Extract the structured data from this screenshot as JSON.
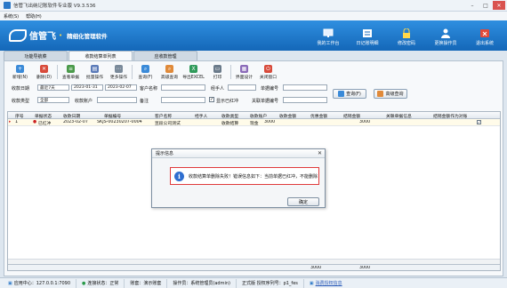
{
  "window": {
    "title": "信管飞出纳记账软件专业版 V9.3.536"
  },
  "menu": [
    "系统(S)",
    "帮助(H)"
  ],
  "banner": {
    "brand": "信管飞",
    "slogan": "精细化管理软件"
  },
  "top_buttons": [
    "我的工作台",
    "日记账明细",
    "修改密码",
    "更换操作员",
    "退出系统"
  ],
  "tabs": [
    "功能导航菜",
    "收款结算单列表",
    "应收款管理"
  ],
  "toolbar": [
    "新增(N)",
    "删除(D)",
    "查看单据",
    "批量操作",
    "更多操作",
    "查询(F)",
    "高级查询",
    "导出EXCEL",
    "打印",
    "界面设计",
    "关闭窗口"
  ],
  "filter": {
    "date_label": "收款日期",
    "date_range": "最近7天",
    "date_from": "2023-01-31",
    "date_to": "2023-02-07",
    "customer_label": "客户名称",
    "customer_value": "",
    "handler_label": "经手人",
    "doc_no_label": "单据编号",
    "type_label": "收款类型",
    "type_value": "全部",
    "account_label": "收款账户",
    "note_label": "备注",
    "show_voided": "显示已红冲",
    "related_doc_label": "关联单据编号",
    "search_btn": "查询(F)",
    "advanced_btn": "高级查询"
  },
  "grid": {
    "columns": [
      "序号",
      "单据状态",
      "收款日期",
      "单据编号",
      "客户名称",
      "经手人",
      "收款类型",
      "收款账户",
      "收款金额",
      "优惠金额",
      "结销金额",
      "关联单据信息",
      "结销金额作为对账"
    ],
    "rows": [
      {
        "index": "1",
        "status": "已红冲",
        "date": "2023-02-07",
        "doc_no": "SKJS-00230207-0004",
        "customer": "豆段公司测试",
        "handler": "",
        "type": "收款结算",
        "account": "现金",
        "amount": "3000",
        "discount": "",
        "settle": "3000",
        "related": "",
        "checked": true
      }
    ],
    "footer": {
      "amount_total": "3000",
      "settle_total": "3000"
    }
  },
  "dialog": {
    "title": "提示信息",
    "message": "收款结算单删除失败！错误信息如下：当前单据已红冲，不能删除",
    "ok": "确定"
  },
  "status": {
    "server": "应用中心：127.0.0.1:7090",
    "connection": "连接状态：正常",
    "account_set": "账套：演示账套",
    "operator": "操作员：系统管理员(admin)",
    "edition": "正式版 授权序列号：p1_fes",
    "link": "消费授权信息"
  }
}
